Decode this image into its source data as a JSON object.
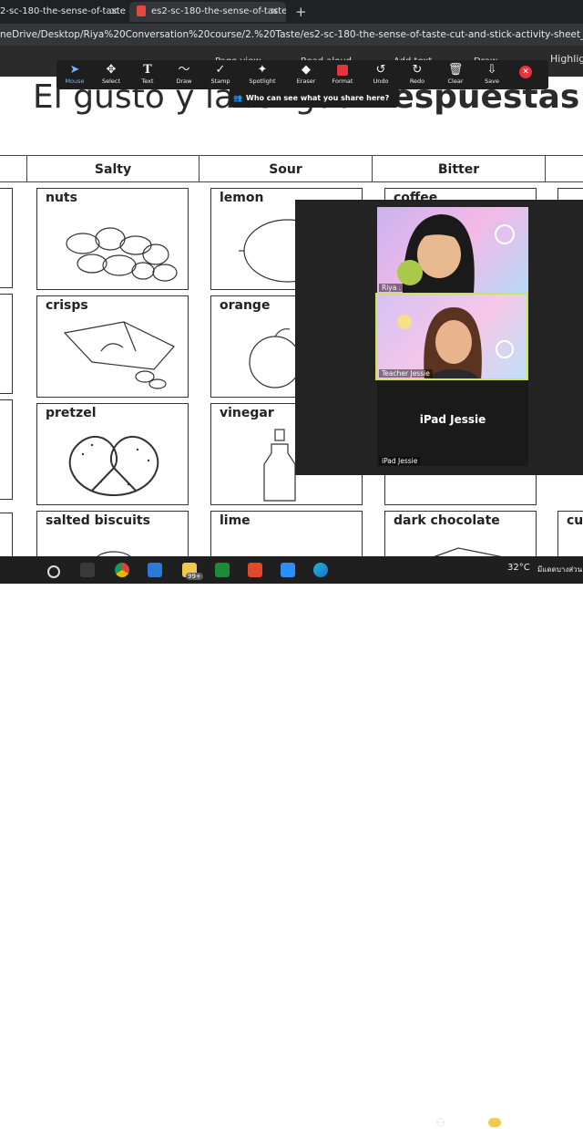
{
  "browser": {
    "tabs": [
      {
        "label": "2-sc-180-the-sense-of-taste-c"
      },
      {
        "label": "es2-sc-180-the-sense-of-taste-c"
      }
    ],
    "new_tab_icon": "plus-icon",
    "url": "neDrive/Desktop/Riya%20Conversation%20course/2.%20Taste/es2-sc-180-the-sense-of-taste-cut-and-stick-activity-sheet_ver_1.pdf",
    "pdf_toolbar": {
      "page_view": "Page view",
      "read_aloud": "Read aloud",
      "add_text": "Add text",
      "draw": "Draw",
      "highlight": "Highligh"
    }
  },
  "annotation_toolbar": {
    "tools": [
      {
        "label": "Mouse",
        "icon": "cursor-icon",
        "active": true
      },
      {
        "label": "Select",
        "icon": "move-icon"
      },
      {
        "label": "Text",
        "icon": "text-icon"
      },
      {
        "label": "Draw",
        "icon": "draw-icon"
      },
      {
        "label": "Stamp",
        "icon": "check-icon"
      },
      {
        "label": "Spotlight",
        "icon": "spotlight-icon"
      },
      {
        "label": "Eraser",
        "icon": "eraser-icon"
      },
      {
        "label": "Format",
        "icon": "format-icon"
      },
      {
        "label": "Undo",
        "icon": "undo-icon"
      },
      {
        "label": "Redo",
        "icon": "redo-icon"
      },
      {
        "label": "Clear",
        "icon": "trash-icon"
      },
      {
        "label": "Save",
        "icon": "save-icon"
      }
    ],
    "share_tip": "Who can see what you share here?",
    "format_color": "#e5343d"
  },
  "document": {
    "title_normal": "El gusto y la lengua ",
    "title_bold": "Respuestas",
    "columns": [
      "",
      "Salty",
      "Sour",
      "Bitter",
      ""
    ],
    "cards": {
      "salty": [
        "nuts",
        "crisps",
        "pretzel",
        "salted biscuits"
      ],
      "sour": [
        "lemon",
        "orange",
        "vinegar",
        "lime"
      ],
      "bitter": [
        "coffee",
        "",
        "",
        "dark chocolate"
      ],
      "right_edge": "cu"
    }
  },
  "video_panel": {
    "participants": [
      {
        "name": "Riya ."
      },
      {
        "name": "Teacher Jessie"
      },
      {
        "name": "iPad Jessie",
        "caption": "iPad Jessie"
      }
    ]
  },
  "taskbar": {
    "badge": "99+",
    "temperature": "32°C",
    "locale_text": "มีแดดบางส่วน"
  }
}
